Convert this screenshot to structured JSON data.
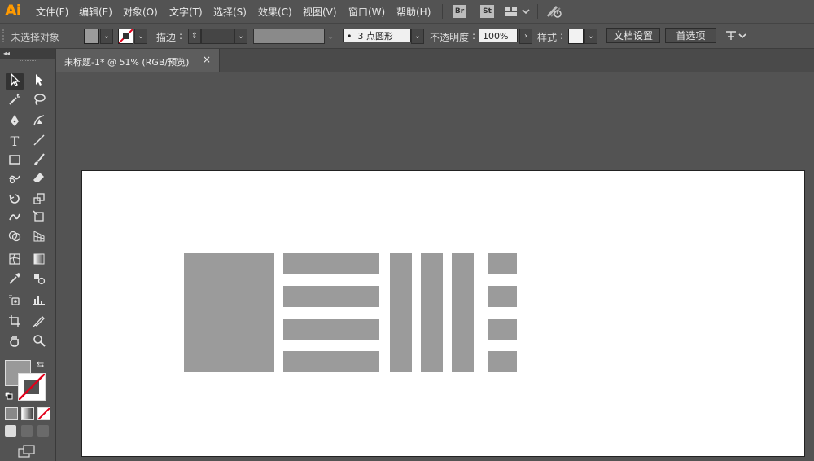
{
  "app": {
    "logo": "Ai"
  },
  "menu": {
    "items": [
      "文件(F)",
      "编辑(E)",
      "对象(O)",
      "文字(T)",
      "选择(S)",
      "效果(C)",
      "视图(V)",
      "窗口(W)",
      "帮助(H)"
    ],
    "bridge_badge": "Br",
    "stock_badge": "St"
  },
  "control_bar": {
    "selection_status": "未选择对象",
    "stroke_label": "描边",
    "brush_value": "3 点圆形",
    "opacity_label": "不透明度",
    "opacity_value": "100%",
    "style_label": "样式",
    "document_setup_button": "文档设置",
    "preferences_button": "首选项"
  },
  "document": {
    "tab_title": "未标题-1* @ 51% (RGB/预览)",
    "close_glyph": "×"
  },
  "colors": {
    "shape_fill": "#9b9b9b",
    "artboard": "#ffffff",
    "ui_background": "#535353",
    "logo": "#ff9a00"
  }
}
